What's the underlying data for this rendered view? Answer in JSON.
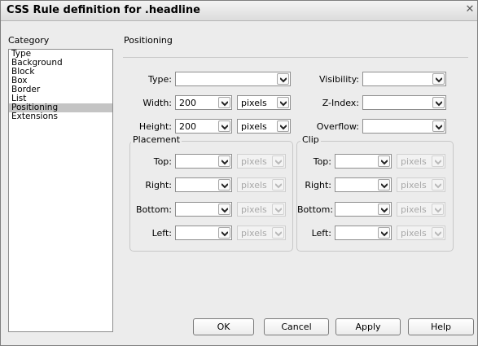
{
  "window": {
    "title": "CSS Rule definition for .headline"
  },
  "category": {
    "heading": "Category",
    "items": [
      "Type",
      "Background",
      "Block",
      "Box",
      "Border",
      "List",
      "Positioning",
      "Extensions"
    ],
    "selected": "Positioning"
  },
  "panel": {
    "heading": "Positioning"
  },
  "fields": {
    "type": {
      "label": "Type:",
      "value": ""
    },
    "width": {
      "label": "Width:",
      "value": "200",
      "unit": "pixels"
    },
    "height": {
      "label": "Height:",
      "value": "200",
      "unit": "pixels"
    },
    "visibility": {
      "label": "Visibility:",
      "value": ""
    },
    "zindex": {
      "label": "Z-Index:",
      "value": ""
    },
    "overflow": {
      "label": "Overflow:",
      "value": ""
    }
  },
  "placement": {
    "label": "Placement",
    "rows": [
      {
        "label": "Top:",
        "value": "",
        "unit": "pixels"
      },
      {
        "label": "Right:",
        "value": "",
        "unit": "pixels"
      },
      {
        "label": "Bottom:",
        "value": "",
        "unit": "pixels"
      },
      {
        "label": "Left:",
        "value": "",
        "unit": "pixels"
      }
    ]
  },
  "clip": {
    "label": "Clip",
    "rows": [
      {
        "label": "Top:",
        "value": "",
        "unit": "pixels"
      },
      {
        "label": "Right:",
        "value": "",
        "unit": "pixels"
      },
      {
        "label": "Bottom:",
        "value": "",
        "unit": "pixels"
      },
      {
        "label": "Left:",
        "value": "",
        "unit": "pixels"
      }
    ]
  },
  "buttons": {
    "ok": "OK",
    "cancel": "Cancel",
    "apply": "Apply",
    "help": "Help"
  },
  "icons": {
    "close": "close-icon",
    "dropdown": "chevron-down-icon"
  }
}
